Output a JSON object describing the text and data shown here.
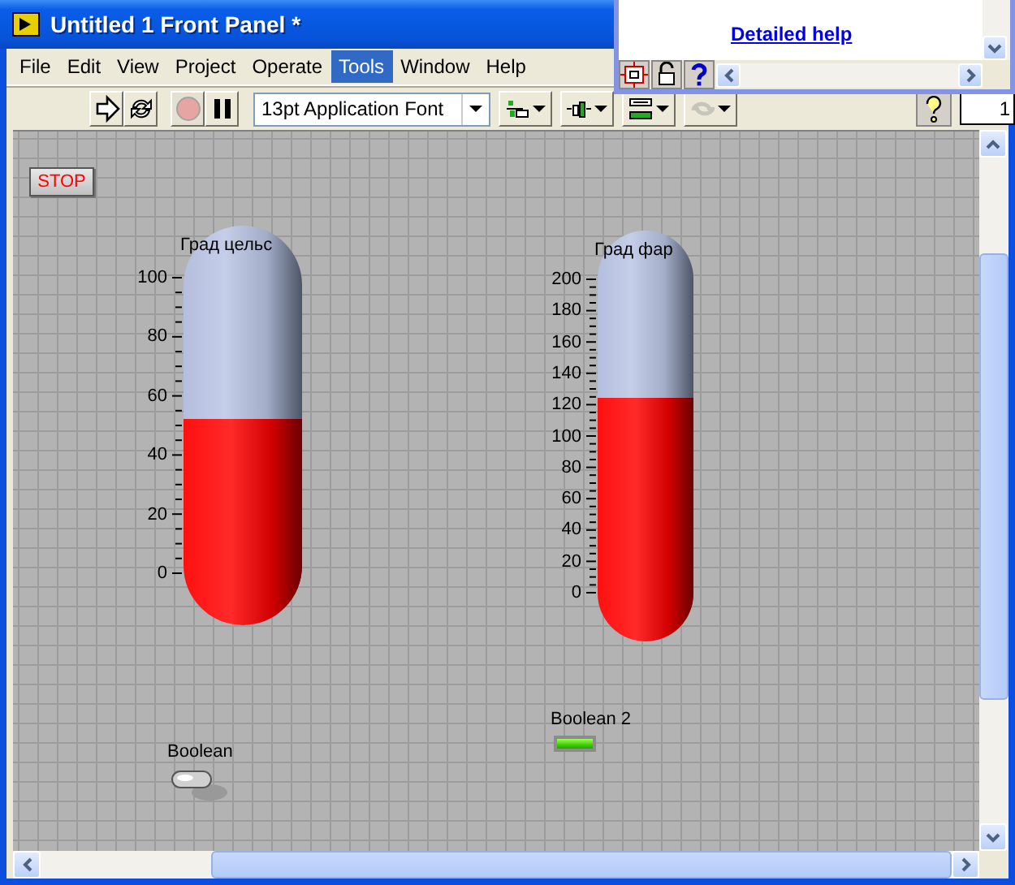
{
  "window": {
    "title": "Untitled 1 Front Panel *"
  },
  "context_help": {
    "link": "Detailed help"
  },
  "menu": [
    {
      "label": "File",
      "selected": false
    },
    {
      "label": "Edit",
      "selected": false
    },
    {
      "label": "View",
      "selected": false
    },
    {
      "label": "Project",
      "selected": false
    },
    {
      "label": "Operate",
      "selected": false
    },
    {
      "label": "Tools",
      "selected": true
    },
    {
      "label": "Window",
      "selected": false
    },
    {
      "label": "Help",
      "selected": false
    }
  ],
  "toolbar": {
    "buttons": [
      {
        "kind": "run",
        "disabled": false
      },
      {
        "kind": "run-continuous",
        "disabled": false
      },
      {
        "kind": "abort",
        "disabled": true
      },
      {
        "kind": "pause",
        "disabled": false
      }
    ],
    "font_menu": "13pt Application Font",
    "tools": [
      {
        "kind": "align",
        "disabled": false
      },
      {
        "kind": "distribute",
        "disabled": false
      },
      {
        "kind": "resize",
        "disabled": false
      },
      {
        "kind": "reorder",
        "disabled": true
      }
    ],
    "field": "1"
  },
  "panel": {
    "stop_button": {
      "label": "STOP"
    },
    "thermometers": [
      {
        "label": "Град цельс",
        "ticks": [
          "100",
          "80",
          "60",
          "40",
          "20",
          "0"
        ],
        "level": 0.52
      },
      {
        "label": "Град фар",
        "ticks": [
          "200",
          "180",
          "160",
          "140",
          "120",
          "100",
          "80",
          "60",
          "40",
          "20",
          "0"
        ],
        "level": 0.62
      }
    ],
    "switch": {
      "label": "Boolean",
      "on": false
    },
    "led": {
      "label": "Boolean 2",
      "on": true
    }
  }
}
